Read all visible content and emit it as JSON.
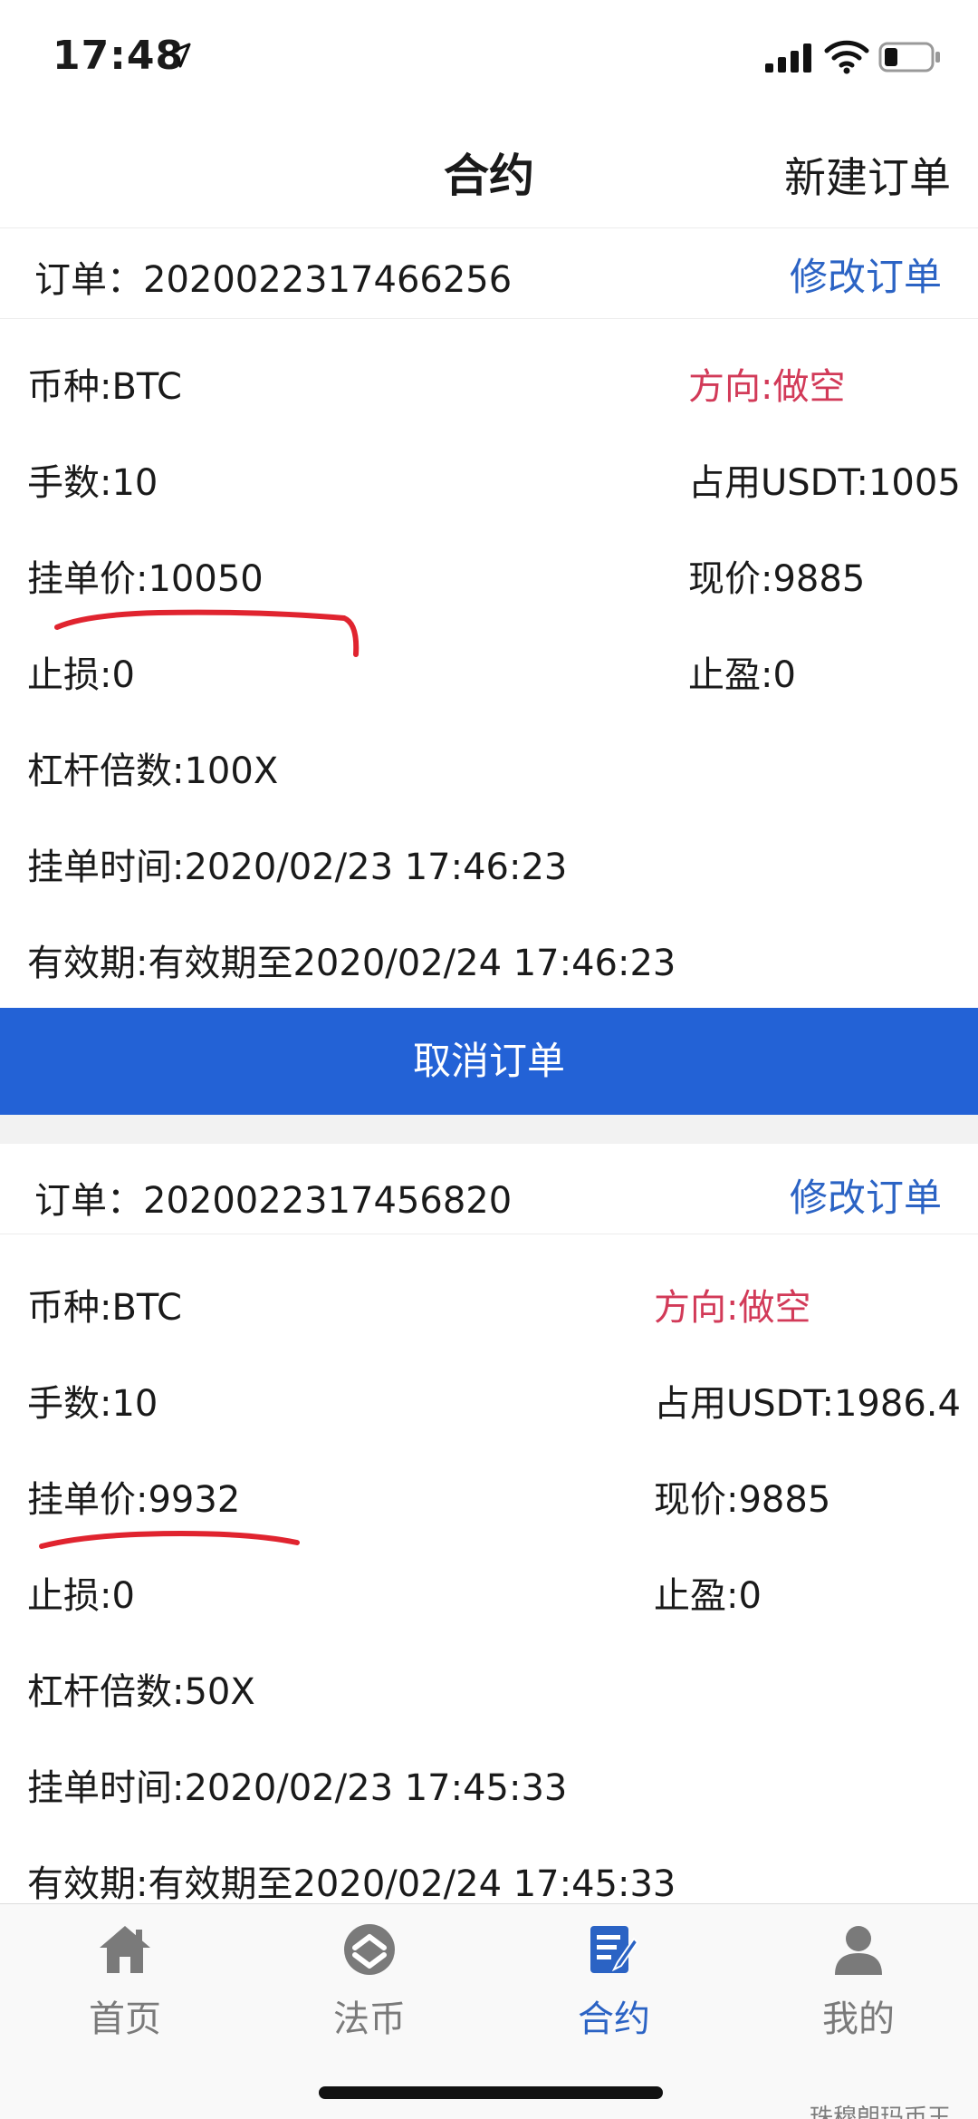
{
  "status": {
    "time": "17:48"
  },
  "header": {
    "title": "合约",
    "action": "新建订单"
  },
  "orders": [
    {
      "id_text": "订单：2020022317466256",
      "edit_label": "修改订单",
      "coin": "币种:BTC",
      "direction": "方向:做空",
      "lots": "手数:10",
      "usdt": "占用USDT:1005",
      "limit_price": "挂单价:10050",
      "current_price": "现价:9885",
      "stop_loss": "止损:0",
      "take_profit": "止盈:0",
      "leverage": "杠杆倍数:100X",
      "order_time": "挂单时间:2020/02/23 17:46:23",
      "validity": "有效期:有效期至2020/02/24 17:46:23",
      "cancel_label": "取消订单"
    },
    {
      "id_text": "订单：2020022317456820",
      "edit_label": "修改订单",
      "coin": "币种:BTC",
      "direction": "方向:做空",
      "lots": "手数:10",
      "usdt": "占用USDT:1986.4",
      "limit_price": "挂单价:9932",
      "current_price": "现价:9885",
      "stop_loss": "止损:0",
      "take_profit": "止盈:0",
      "leverage": "杠杆倍数:50X",
      "order_time": "挂单时间:2020/02/23 17:45:33",
      "validity": "有效期:有效期至2020/02/24 17:45:33"
    }
  ],
  "tabbar": {
    "items": [
      {
        "label": "首页",
        "icon": "home-icon"
      },
      {
        "label": "法币",
        "icon": "exchange-icon"
      },
      {
        "label": "合约",
        "icon": "contract-icon",
        "active": true
      },
      {
        "label": "我的",
        "icon": "user-icon"
      }
    ]
  },
  "watermark": "珠穆朗玛币王",
  "colors": {
    "accent": "#2362d6",
    "link": "#2b63c4",
    "short": "#d23a58",
    "annotation": "#e0242f"
  }
}
